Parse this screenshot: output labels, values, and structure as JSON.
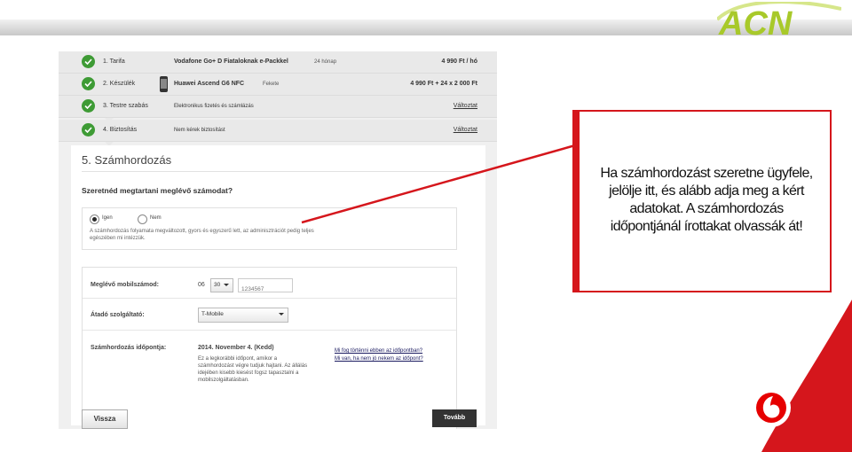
{
  "brand": {
    "logo_text": "ACN",
    "logo_color": "#a8c92a",
    "accent_red": "#d5161c",
    "check_green": "#3e9b35"
  },
  "steps": [
    {
      "label": "1. Tarifa",
      "name": "Vodafone Go+ D Fiataloknak e-Packkel",
      "mid": "24 hónap",
      "right": "4 990 Ft / hó"
    },
    {
      "label": "2. Készülék",
      "name": "Huawei Ascend G6 NFC",
      "mid": "Fekete",
      "right": "4 990 Ft + 24 x 2 000 Ft"
    },
    {
      "label": "3. Testre szabás",
      "name": "Elektronikus fizetés és számlázás",
      "right": "Változtat"
    },
    {
      "label": "4. Biztosítás",
      "name": "Nem kérek biztosítást",
      "right": "Változtat"
    }
  ],
  "section": {
    "title": "5. Számhordozás",
    "question": "Szeretnéd megtartani meglévő számodat?",
    "yes": "Igen",
    "no": "Nem",
    "notice_line1": "A számhordozás folyamata megváltozott, gyors és egyszerű lett, az adminisztrációt pedig teljes",
    "notice_line2": "egészében mi intézzük."
  },
  "form": {
    "number_label": "Meglévő mobilszámod:",
    "prefix": "06",
    "area_code": "30",
    "number_placeholder": "1234567",
    "provider_label": "Átadó szolgáltató:",
    "provider_value": "T-Mobile",
    "date_label": "Számhordozás időpontja:",
    "date_value": "2014. November 4. (Kedd)",
    "date_info": [
      "Ez a legkorábbi időpont, amikor a",
      "számhordozást végre tudjuk hajtani. Az állálás",
      "idejében kisebb kiesést fogsz tapasztalni a",
      "mobilszolgáltatásban."
    ],
    "link1": "Mi fog történni ebben az időpontban?",
    "link2": "Mi van, ha nem jó nekem az időpont?"
  },
  "buttons": {
    "back": "Vissza",
    "next": "Tovább"
  },
  "callout": {
    "line1": "Ha számhordozást szeretne ügyfele,",
    "line2": "jelölje itt, és alább adja meg a kért",
    "line3": "adatokat. A számhordozás",
    "line4": "időpontjánál írottakat olvassák át!"
  }
}
